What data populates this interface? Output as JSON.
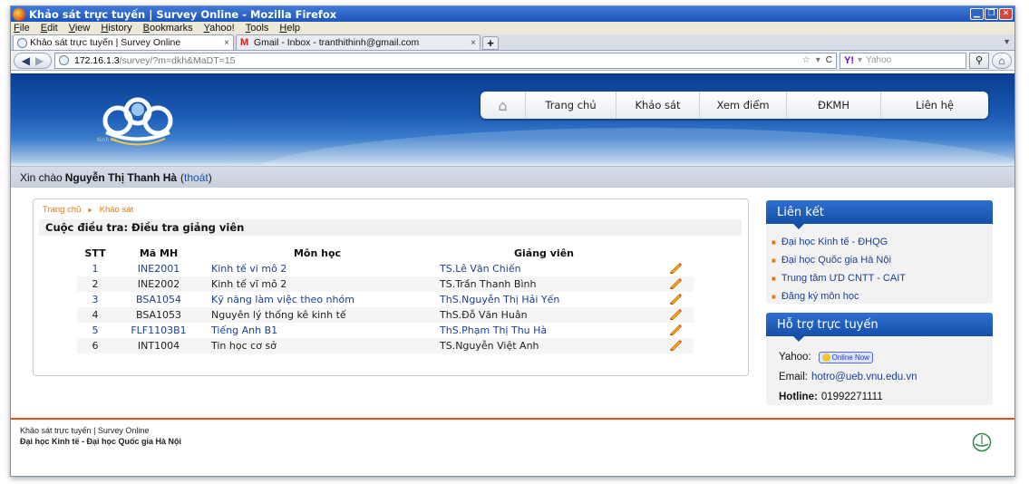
{
  "window": {
    "title": "Khảo sát trực tuyến | Survey Online - Mozilla Firefox"
  },
  "menu": [
    "File",
    "Edit",
    "View",
    "History",
    "Bookmarks",
    "Yahoo!",
    "Tools",
    "Help"
  ],
  "tabs": [
    {
      "label": "Khảo sát trực tuyến | Survey Online",
      "close": "×"
    },
    {
      "label": "Gmail - Inbox - tranthithinh@gmail.com",
      "close": "×"
    }
  ],
  "new_tab": "+",
  "address": {
    "host": "172.16.1.3",
    "path": "/survey/?m=dkh&MaDT=15"
  },
  "search": {
    "engine": "Y!",
    "placeholder": "Yahoo"
  },
  "nav": {
    "items": [
      "Trang chủ",
      "Khảo sát",
      "Xem điểm",
      "ĐKMH",
      "Liên hệ"
    ]
  },
  "logo_caption": "Kinh tế",
  "welcome": {
    "prefix": "Xin chào",
    "name": "Nguyễn Thị Thanh Hà",
    "open": "(",
    "logout": "thoát",
    "close": ")"
  },
  "breadcrumb": [
    "Trang chủ",
    "Khảo sát"
  ],
  "survey_title": "Cuộc điều tra: Điều tra giảng viên",
  "table": {
    "headers": [
      "STT",
      "Mã MH",
      "Môn học",
      "Giảng viên"
    ],
    "rows": [
      {
        "stt": "1",
        "ma": "INE2001",
        "mon": "Kinh tế vi mô 2",
        "gv": "TS.Lê Văn Chiến",
        "highlight": true
      },
      {
        "stt": "2",
        "ma": "INE2002",
        "mon": "Kinh tế vĩ mô 2",
        "gv": "TS.Trần Thanh Bình",
        "highlight": false
      },
      {
        "stt": "3",
        "ma": "BSA1054",
        "mon": "Kỹ năng làm việc theo nhóm",
        "gv": "ThS.Nguyễn Thị Hải Yến",
        "highlight": true
      },
      {
        "stt": "4",
        "ma": "BSA1053",
        "mon": "Nguyên lý thống kê kinh tế",
        "gv": "ThS.Đỗ Văn Huân",
        "highlight": false
      },
      {
        "stt": "5",
        "ma": "FLF1103B1",
        "mon": "Tiếng Anh B1",
        "gv": "ThS.Phạm Thị Thu Hà",
        "highlight": true
      },
      {
        "stt": "6",
        "ma": "INT1004",
        "mon": "Tin học cơ sở",
        "gv": "TS.Nguyễn Việt Anh",
        "highlight": false
      }
    ]
  },
  "sidebar": {
    "links_title": "Liên kết",
    "links": [
      "Đại học Kinh tế - ĐHQG",
      "Đại học Quốc gia Hà Nội",
      "Trung tâm ƯD CNTT - CAIT",
      "Đăng ký môn học"
    ],
    "support_title": "Hỗ trợ trực tuyến",
    "yahoo_label": "Yahoo:",
    "online_badge": "Online Now",
    "email_label": "Email:",
    "email": "hotro@ueb.vnu.edu.vn",
    "hotline_label": "Hotline:",
    "hotline": "01992271111"
  },
  "footer": {
    "line1": "Khảo sát trực tuyến | Survey Online",
    "line2": "Đại học Kinh tế - Đại học Quốc gia Hà Nội"
  },
  "colors": {
    "accent_blue": "#1450a8",
    "link_blue": "#1c3f92",
    "orange": "#e07a10",
    "footer_line": "#e5501b"
  }
}
